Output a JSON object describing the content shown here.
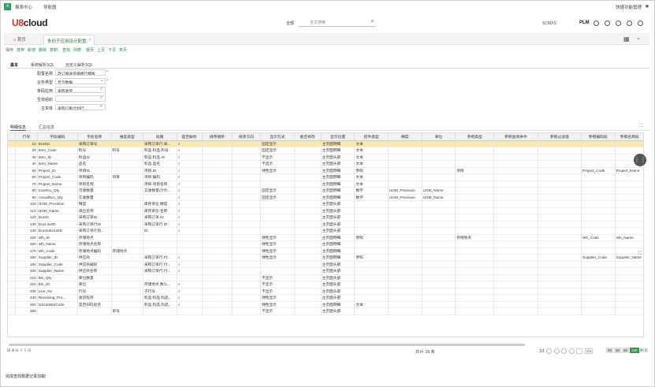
{
  "os": {
    "logo": "≡",
    "tab1": "报表中心",
    "tab2": "导航图",
    "right_label": "快捷功能管理",
    "star": "★"
  },
  "header": {
    "logo_a": "U8",
    "logo_b": "cloud",
    "scope": "全部",
    "search_placeholder": "全文搜索",
    "user": "SCMXS",
    "plm": "PLM"
  },
  "tabs": {
    "home": "首页",
    "active": "条码子应用设计配置"
  },
  "toolbar": [
    "保存",
    "放弃",
    "新增",
    "删除",
    "复制",
    "查找",
    "列表",
    "首页",
    "上页",
    "下页",
    "末页"
  ],
  "basetabs": [
    "基本",
    "系统解析SQL",
    "自定义解析SQL"
  ],
  "form": [
    {
      "label": "配置名称",
      "value": "改订单收货单模行模板",
      "req": true,
      "icon": ""
    },
    {
      "label": "业务类型",
      "value": "显示数据",
      "req": true,
      "icon": "⌄"
    },
    {
      "label": "条码应用",
      "value": "采购收货",
      "req": false,
      "icon": "⌕"
    },
    {
      "label": "生效组织",
      "value": "",
      "req": false,
      "icon": "⌕"
    },
    {
      "label": "主实体",
      "value": "采购订单计划行",
      "req": false,
      "icon": "⌕"
    }
  ],
  "subtabs": [
    "明细信息",
    "汇总信息"
  ],
  "columns": [
    "",
    "行号",
    "字段编码",
    "字段名称",
    "维度类型",
    "段路",
    "是否解析",
    "排序顺序",
    "排序方向",
    "显示方式",
    "能否修改",
    "显示位置",
    "控件类型",
    "精度",
    "单位",
    "参照类型",
    "参照查询条件",
    "参照过滤值",
    "参照编码段",
    "参照名称段"
  ],
  "rows": [
    [
      "",
      "10",
      "DocNo",
      "采购订单号",
      "",
      "采购订单行.采...",
      "√",
      "",
      "",
      "固定显示",
      "",
      "主页面明细",
      "文本",
      "",
      "",
      "",
      "",
      "",
      "",
      ""
    ],
    [
      "",
      "20",
      "Item_Code",
      "料号",
      "料号",
      "料品.料品.料号",
      "√",
      "",
      "",
      "固定显示",
      "",
      "主页面明细",
      "文本",
      "",
      "",
      "",
      "",
      "",
      "",
      ""
    ],
    [
      "",
      "30",
      "Item_ID",
      "料品ID",
      "",
      "料品.料品.ID",
      "√",
      "",
      "",
      "不显示",
      "",
      "主页面头部",
      "文本",
      "",
      "",
      "",
      "",
      "",
      "",
      ""
    ],
    [
      "",
      "40",
      "Item_Name",
      "品名",
      "",
      "料品.品名",
      "√",
      "",
      "",
      "不显示",
      "",
      "主页面头部",
      "文本",
      "",
      "",
      "",
      "",
      "",
      "",
      ""
    ],
    [
      "",
      "50",
      "Project_ID",
      "项目ID",
      "",
      "项目.ID",
      "√",
      "",
      "",
      "弹性显示",
      "",
      "主页面明细",
      "参照",
      "",
      "",
      "项目",
      "",
      "",
      "Project_Code",
      "Project_Name"
    ],
    [
      "",
      "60",
      "Project_Code",
      "项目编码",
      "项目",
      "项目.编码",
      "√",
      "",
      "",
      "",
      "",
      "主页面明细",
      "文本",
      "",
      "",
      "",
      "",
      "",
      "",
      ""
    ],
    [
      "",
      "70",
      "Project_Name",
      "项目名称",
      "",
      "项目.项目名称",
      "√",
      "",
      "",
      "",
      "",
      "主页面明细",
      "文本",
      "",
      "",
      "",
      "",
      "",
      "",
      ""
    ],
    [
      "",
      "80",
      "CanRcv_Qty",
      "可收数量",
      "",
      "又收数量(计价...",
      "√",
      "",
      "",
      "固定显示",
      "",
      "主页面明细",
      "数字",
      "UOM_Precision",
      "UOM_Name",
      "",
      "",
      "",
      "",
      ""
    ],
    [
      "",
      "90",
      "ActualRcv_Qty",
      "实收数量",
      "",
      "",
      "√",
      "",
      "",
      "固定显示",
      "",
      "主页面明细",
      "数字",
      "UOM_Precision",
      "UOM_Name",
      "",
      "",
      "",
      "",
      ""
    ],
    [
      "",
      "100",
      "UOM_Precision",
      "精度",
      "",
      "库存单位.精度",
      "√",
      "",
      "",
      "",
      "",
      "主页面头部",
      "",
      "",
      "",
      "",
      "",
      "",
      "",
      ""
    ],
    [
      "",
      "110",
      "UOM_Name",
      "单位名称",
      "",
      "库存单位.名称",
      "√",
      "",
      "",
      "",
      "",
      "主页面头部",
      "",
      "",
      "",
      "",
      "",
      "",
      "",
      ""
    ],
    [
      "",
      "120",
      "DocID",
      "采购订单ID",
      "",
      "采购订单.ID",
      "√",
      "",
      "",
      "",
      "",
      "主页面头部",
      "",
      "",
      "",
      "",
      "",
      "",
      "",
      ""
    ],
    [
      "",
      "130",
      "DocLineID",
      "采购订单行ID",
      "",
      "采购订单行.ID",
      "√",
      "",
      "",
      "",
      "",
      "主页面头部",
      "",
      "",
      "",
      "",
      "",
      "",
      "",
      ""
    ],
    [
      "",
      "140",
      "DocSubLineID",
      "采购订单计划...",
      "",
      "ID",
      "√",
      "",
      "",
      "",
      "",
      "主页面头部",
      "",
      "",
      "",
      "",
      "",
      "",
      "",
      ""
    ],
    [
      "",
      "150",
      "Wh_ID",
      "存储地点",
      "",
      "",
      "",
      "",
      "",
      "弹性显示",
      "",
      "主页面明细",
      "参照",
      "",
      "",
      "存储地点",
      "",
      "",
      "Wh_Code",
      "Wh_Name"
    ],
    [
      "",
      "160",
      "Wh_Name",
      "存储地点名称",
      "",
      "",
      "",
      "",
      "",
      "弹性显示",
      "",
      "主页面明细",
      "",
      "",
      "",
      "",
      "",
      "",
      "",
      ""
    ],
    [
      "",
      "170",
      "Wh_Code",
      "存储地点编码",
      "存储地点",
      "",
      "",
      "",
      "",
      "弹性显示",
      "",
      "主页面明细",
      "",
      "",
      "",
      "",
      "",
      "",
      "",
      ""
    ],
    [
      "",
      "180",
      "Supplier_ID",
      "供应商",
      "",
      "采购订单行.付...",
      "√",
      "",
      "",
      "弹性显示",
      "",
      "主页面明细",
      "参照",
      "",
      "",
      "",
      "",
      "",
      "Supplier_Code",
      "Supplier_Name"
    ],
    [
      "",
      "190",
      "Supplier_Code",
      "供应商编码",
      "",
      "采购订单行.付...",
      "√",
      "",
      "",
      "",
      "",
      "主页面头部",
      "",
      "",
      "",
      "",
      "",
      "",
      "",
      ""
    ],
    [
      "",
      "200",
      "Supplier_Name",
      "供应商名称",
      "",
      "采购订单行.付...",
      "√",
      "",
      "",
      "",
      "",
      "主页面头部",
      "",
      "",
      "",
      "",
      "",
      "",
      "",
      ""
    ],
    [
      "",
      "210",
      "Bin_Qty",
      "库位数量",
      "",
      "",
      "",
      "",
      "",
      "不显示",
      "",
      "主页面头部",
      "",
      "",
      "",
      "",
      "",
      "",
      "",
      ""
    ],
    [
      "",
      "220",
      "Bin_ID",
      "库位",
      "",
      "存储地点.数认...",
      "√",
      "",
      "",
      "不显示",
      "",
      "主页面头部",
      "",
      "",
      "",
      "",
      "",
      "",
      "",
      ""
    ],
    [
      "",
      "230",
      "Line_No",
      "行号",
      "",
      "子行号",
      "√",
      "",
      "",
      "不显示",
      "",
      "主页面头部",
      "",
      "",
      "",
      "",
      "",
      "",
      "",
      ""
    ],
    [
      "",
      "240",
      "Receiving_Pro...",
      "收货程序",
      "",
      "料品.料品.料品...",
      "√",
      "",
      "",
      "弹性显示",
      "",
      "主页面头部",
      "",
      "",
      "",
      "",
      "",
      "",
      "",
      ""
    ],
    [
      "",
      "250",
      "IsScanBarCode",
      "是否扫码验货",
      "",
      "料品.料品.料品...",
      "√",
      "",
      "",
      "弹性显示",
      "",
      "主页面明细",
      "文本",
      "",
      "",
      "",
      "",
      "",
      "",
      ""
    ],
    [
      "",
      "260",
      "",
      "",
      "单号",
      "",
      "",
      "",
      "",
      "不显示",
      "",
      "主页面头部",
      "",
      "",
      "",
      "",
      "",
      "",
      "",
      ""
    ]
  ],
  "footer": {
    "tools": "⊞⊕⊖⇧⇩⊘",
    "total": "共计: 25 条",
    "page": "1/1",
    "go": "Go",
    "sizes": [
      "20",
      "30",
      "50",
      "100"
    ],
    "per": "条/页"
  },
  "status": "完成查找数据记录加载!"
}
